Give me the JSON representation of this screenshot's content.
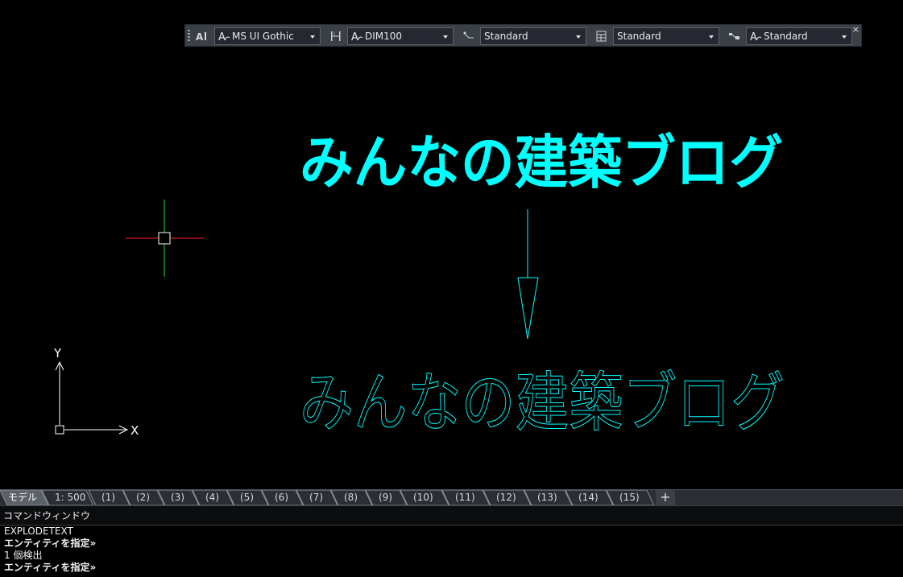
{
  "toolbar": {
    "text_style": "MS UI Gothic",
    "dim_style": "DIM100",
    "leader_style": "Standard",
    "table_style": "Standard",
    "mleader_style": "Standard",
    "close": "×"
  },
  "canvas": {
    "text_color": "#00ffff",
    "filled_text": "みんなの建築ブログ",
    "outline_text": "みんなの建築ブログ",
    "ucs_x": "X",
    "ucs_y": "Y"
  },
  "tabs": [
    "モデル",
    "1: 500",
    "(1)",
    "(2)",
    "(3)",
    "(4)",
    "(5)",
    "(6)",
    "(7)",
    "(8)",
    "(9)",
    "(10)",
    "(11)",
    "(12)",
    "(13)",
    "(14)",
    "(15)"
  ],
  "tab_add": "+",
  "command_window": {
    "title": "コマンドウィンドウ",
    "lines": [
      {
        "text": "EXPLODETEXT",
        "bold": false
      },
      {
        "text": "エンティティを指定»",
        "bold": true
      },
      {
        "text": "1 個検出",
        "bold": false
      },
      {
        "text": "エンティティを指定»",
        "bold": true
      }
    ]
  }
}
